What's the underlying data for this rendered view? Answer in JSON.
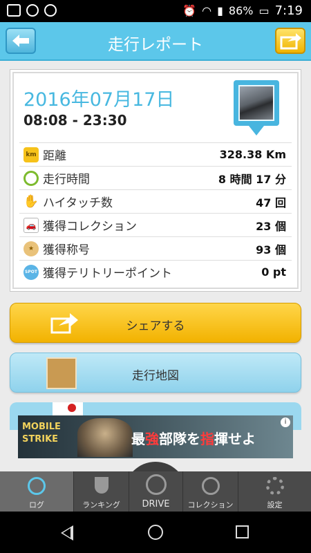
{
  "status_bar": {
    "battery": "86%",
    "time": "7:19"
  },
  "header": {
    "title": "走行レポート"
  },
  "report": {
    "date": "2016年07月17日",
    "time_range": "08:08 - 23:30",
    "stats": [
      {
        "icon": "km-icon",
        "icon_text": "km",
        "label": "距離",
        "value": "328.38 Km"
      },
      {
        "icon": "clock-icon",
        "label": "走行時間",
        "value": "8 時間 17 分"
      },
      {
        "icon": "hand-icon",
        "label": "ハイタッチ数",
        "value": "47 回"
      },
      {
        "icon": "car-icon",
        "label": "獲得コレクション",
        "value": "23 個"
      },
      {
        "icon": "medal-icon",
        "label": "獲得称号",
        "value": "93 個"
      },
      {
        "icon": "spot-icon",
        "icon_text": "SPOT",
        "label": "獲得テリトリーポイント",
        "value": "0 pt"
      }
    ]
  },
  "buttons": {
    "share_label": "シェアする",
    "map_label": "走行地図"
  },
  "ad": {
    "brand_line1": "MOBILE",
    "brand_line2": "STRIKE",
    "catch_1": "最",
    "catch_2": "強",
    "catch_3": "部隊を",
    "catch_4": "指",
    "catch_5": "揮せよ",
    "info": "i"
  },
  "bottom_nav": {
    "log": "ログ",
    "ranking": "ランキング",
    "drive": "DRIVE",
    "collection": "コレクション",
    "settings": "設定"
  },
  "colors": {
    "header": "#5cc7ea",
    "accent_blue": "#47b8e0",
    "share_yellow": "#f2b200"
  }
}
